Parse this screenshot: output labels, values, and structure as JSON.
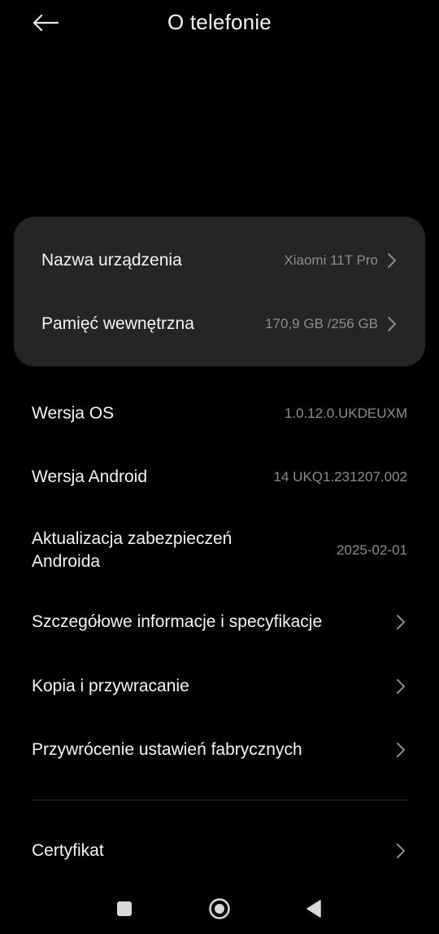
{
  "header": {
    "title": "O telefonie",
    "back_icon": "arrow-left-icon"
  },
  "card": {
    "device_name": {
      "label": "Nazwa urządzenia",
      "value": "Xiaomi 11T Pro"
    },
    "storage": {
      "label": "Pamięć wewnętrzna",
      "value": "170,9 GB /256 GB"
    }
  },
  "info": {
    "os_version": {
      "label": "Wersja OS",
      "value": "1.0.12.0.UKDEUXM"
    },
    "android_version": {
      "label": "Wersja Android",
      "value": "14 UKQ1.231207.002"
    },
    "security_update": {
      "label_line1": "Aktualizacja zabezpieczeń",
      "label_line2": "Androida",
      "value": "2025-02-01"
    }
  },
  "menu": {
    "details": "Szczegółowe informacje i specyfikacje",
    "backup": "Kopia i przywracanie",
    "factory_reset": "Przywrócenie ustawień fabrycznych",
    "certificate": "Certyfikat"
  },
  "colors": {
    "background": "#000000",
    "card": "#252525",
    "primary_text": "#f3f3f3",
    "secondary_text": "#8c8c8c",
    "chevron": "#8a8a8a"
  },
  "navbar": {
    "recents_icon": "square-icon",
    "home_icon": "circle-icon",
    "back_icon": "triangle-back-icon"
  }
}
